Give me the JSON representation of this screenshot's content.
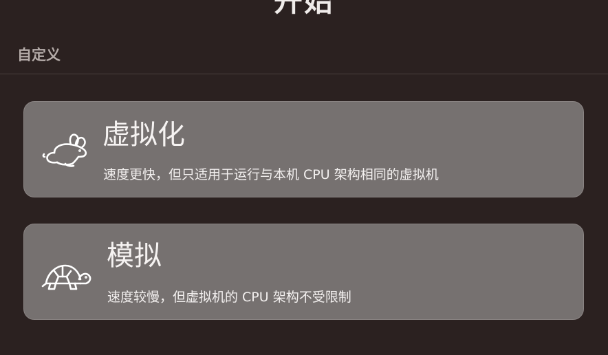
{
  "header": {
    "title": "开始"
  },
  "section": {
    "label": "自定义"
  },
  "options": [
    {
      "icon": "rabbit-icon",
      "title": "虚拟化",
      "description": "速度更快，但只适用于运行与本机 CPU 架构相同的虚拟机"
    },
    {
      "icon": "turtle-icon",
      "title": "模拟",
      "description": "速度较慢，但虚拟机的 CPU 架构不受限制"
    }
  ],
  "colors": {
    "background": "#2b2120",
    "card": "#767170",
    "section_label": "#b5aca9",
    "divider": "#4a403e"
  }
}
